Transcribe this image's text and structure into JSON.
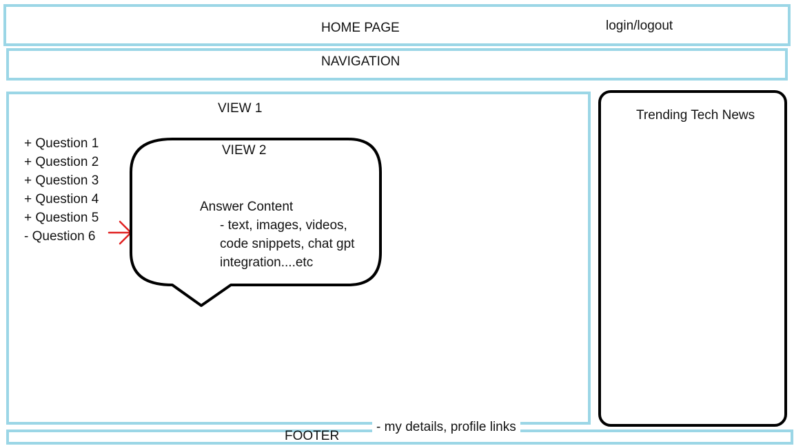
{
  "header": {
    "title": "HOME PAGE",
    "auth_link": "login/logout"
  },
  "navigation": {
    "label": "NAVIGATION"
  },
  "view1": {
    "label": "VIEW 1",
    "questions": [
      "+ Question 1",
      "+ Question 2",
      "+ Question 3",
      "+ Question 4",
      "+ Question 5",
      "- Question 6"
    ]
  },
  "view2": {
    "label": "VIEW 2",
    "answer_title": "Answer Content",
    "answer_lines": [
      "- text, images, videos,",
      "code snippets, chat gpt",
      "integration....etc"
    ]
  },
  "sidebar": {
    "title": "Trending Tech News"
  },
  "footer": {
    "label": "FOOTER",
    "note": "- my details, profile links"
  },
  "colors": {
    "frame_blue": "#9bd6e6",
    "pointer_red": "#e02020",
    "outline_black": "#000000"
  },
  "icons": {
    "pointer": "arrow-right-icon"
  }
}
